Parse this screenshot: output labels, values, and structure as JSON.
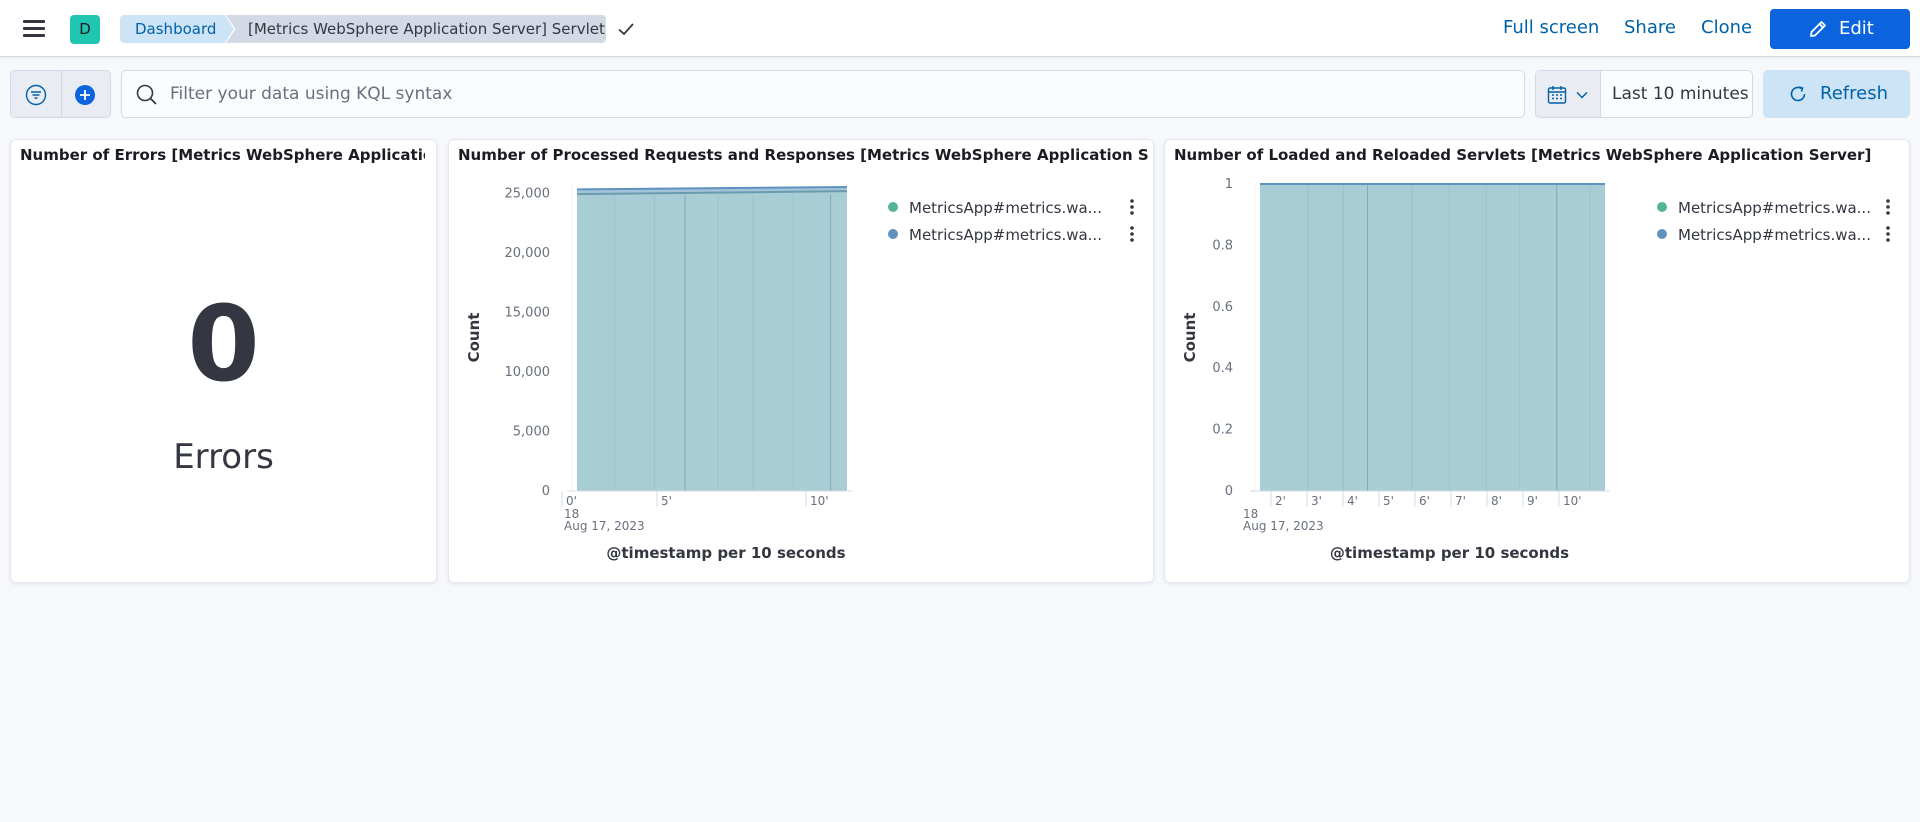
{
  "header": {
    "space_initial": "D",
    "breadcrumbs": [
      "Dashboard",
      "[Metrics WebSphere Application Server] Servlet"
    ],
    "actions": {
      "full_screen": "Full screen",
      "share": "Share",
      "clone": "Clone",
      "edit": "Edit"
    }
  },
  "query": {
    "placeholder": "Filter your data using KQL syntax",
    "date_range": "Last 10 minutes",
    "refresh": "Refresh"
  },
  "panels": {
    "errors": {
      "title": "Number of Errors [Metrics WebSphere Applicatio...",
      "value": "0",
      "label": "Errors"
    },
    "requests": {
      "title": "Number of Processed Requests and Responses [Metrics WebSphere Application Server]"
    },
    "servlets": {
      "title": "Number of Loaded and Reloaded Servlets [Metrics WebSphere Application Server]"
    }
  },
  "chart_data": [
    {
      "type": "area",
      "title": "Number of Processed Requests and Responses [Metrics WebSphere Application Server]",
      "xlabel": "@timestamp per 10 seconds",
      "ylabel": "Count",
      "ylim": [
        0,
        25800
      ],
      "yticks": [
        "0",
        "5,000",
        "10,000",
        "15,000",
        "20,000",
        "25,000"
      ],
      "xticks": [
        "0'",
        "5'",
        "10'"
      ],
      "x_date_hour": "18",
      "x_date": "Aug 17, 2023",
      "x": [
        0,
        11.5
      ],
      "series": [
        {
          "name": "MetricsApp#metrics.wa...",
          "values": [
            24950,
            25200
          ],
          "color": "#54b399"
        },
        {
          "name": "MetricsApp#metrics.wa...",
          "values": [
            25350,
            25550
          ],
          "color": "#6092c0"
        }
      ],
      "legend": "top-right",
      "grid": true
    },
    {
      "type": "area",
      "title": "Number of Loaded and Reloaded Servlets [Metrics WebSphere Application Server]",
      "xlabel": "@timestamp per 10 seconds",
      "ylabel": "Count",
      "ylim": [
        0,
        1
      ],
      "yticks": [
        "0",
        "0.2",
        "0.4",
        "0.6",
        "0.8",
        "1"
      ],
      "xticks": [
        "2'",
        "3'",
        "4'",
        "5'",
        "6'",
        "7'",
        "8'",
        "9'",
        "10'"
      ],
      "x_date_hour": "18",
      "x_date": "Aug 17, 2023",
      "x": [
        2,
        11.3
      ],
      "series": [
        {
          "name": "MetricsApp#metrics.wa...",
          "values": [
            1,
            1
          ],
          "color": "#54b399"
        },
        {
          "name": "MetricsApp#metrics.wa...",
          "values": [
            1,
            1
          ],
          "color": "#6092c0"
        }
      ],
      "legend": "top-right",
      "grid": true
    }
  ]
}
